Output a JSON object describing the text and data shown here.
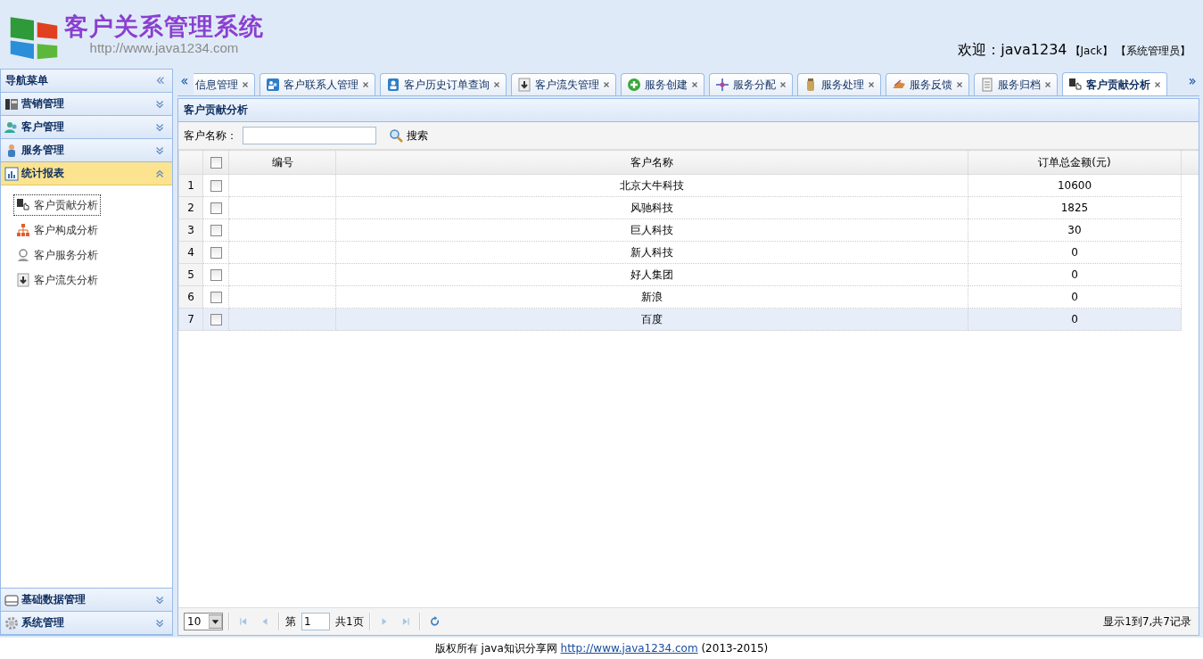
{
  "header": {
    "title": "客户关系管理系统",
    "url": "http://www.java1234.com",
    "welcome": "欢迎：java1234",
    "nickname": "【Jack】",
    "role": "【系统管理员】"
  },
  "sidebar": {
    "title": "导航菜单",
    "sections": [
      {
        "label": "营销管理",
        "expanded": false
      },
      {
        "label": "客户管理",
        "expanded": false
      },
      {
        "label": "服务管理",
        "expanded": false
      },
      {
        "label": "统计报表",
        "expanded": true,
        "children": [
          {
            "label": "客户贡献分析",
            "selected": true
          },
          {
            "label": "客户构成分析",
            "selected": false
          },
          {
            "label": "客户服务分析",
            "selected": false
          },
          {
            "label": "客户流失分析",
            "selected": false
          }
        ]
      },
      {
        "label": "基础数据管理",
        "expanded": false
      },
      {
        "label": "系统管理",
        "expanded": false
      }
    ]
  },
  "tabs": [
    {
      "label": "信息管理",
      "selected": false
    },
    {
      "label": "客户联系人管理",
      "selected": false
    },
    {
      "label": "客户历史订单查询",
      "selected": false
    },
    {
      "label": "客户流失管理",
      "selected": false
    },
    {
      "label": "服务创建",
      "selected": false
    },
    {
      "label": "服务分配",
      "selected": false
    },
    {
      "label": "服务处理",
      "selected": false
    },
    {
      "label": "服务反馈",
      "selected": false
    },
    {
      "label": "服务归档",
      "selected": false
    },
    {
      "label": "客户贡献分析",
      "selected": true
    }
  ],
  "grid": {
    "title": "客户贡献分析",
    "search_label": "客户名称：",
    "search_button": "搜索",
    "header_checked": false,
    "columns": [
      "编号",
      "客户名称",
      "订单总金额(元)"
    ],
    "rows": [
      {
        "number": "1",
        "checked": false,
        "name": "北京大牛科技",
        "amount": "10600",
        "selected": false
      },
      {
        "number": "2",
        "checked": false,
        "name": "风驰科技",
        "amount": "1825",
        "selected": false
      },
      {
        "number": "3",
        "checked": false,
        "name": "巨人科技",
        "amount": "30",
        "selected": false
      },
      {
        "number": "4",
        "checked": false,
        "name": "新人科技",
        "amount": "0",
        "selected": false
      },
      {
        "number": "5",
        "checked": false,
        "name": "好人集团",
        "amount": "0",
        "selected": false
      },
      {
        "number": "6",
        "checked": false,
        "name": "新浪",
        "amount": "0",
        "selected": false
      },
      {
        "number": "7",
        "checked": false,
        "name": "百度",
        "amount": "0",
        "selected": true
      }
    ]
  },
  "pager": {
    "page_size": "10",
    "page_label": "第",
    "page": "1",
    "total_label": "共1页",
    "summary": "显示1到7,共7记录"
  },
  "footer": {
    "text": "版权所有 java知识分享网",
    "link": "http://www.java1234.com",
    "years": "(2013-2015)"
  }
}
